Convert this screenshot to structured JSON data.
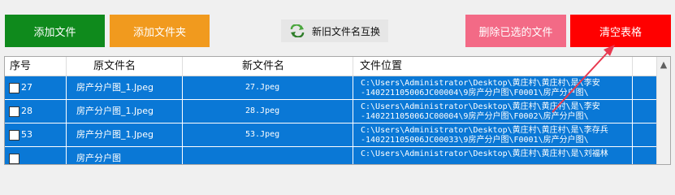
{
  "toolbar": {
    "add_file": "添加文件",
    "add_folder": "添加文件夹",
    "swap": "新旧文件名互换",
    "delete_selected": "删除已选的文件",
    "clear_table": "清空表格"
  },
  "table": {
    "headers": [
      "序号",
      "原文件名",
      "新文件名",
      "文件位置"
    ],
    "rows": [
      {
        "index": "27",
        "original": "房产分户图_1.Jpeg",
        "new_name": "27.Jpeg",
        "path_line1": "C:\\Users\\Administrator\\Desktop\\黄庄村\\黄庄村\\是\\李安",
        "path_line2": "-140221105006JC00004\\9房产分户图\\F0001\\房产分户图\\"
      },
      {
        "index": "28",
        "original": "房产分户图_1.Jpeg",
        "new_name": "28.Jpeg",
        "path_line1": "C:\\Users\\Administrator\\Desktop\\黄庄村\\黄庄村\\是\\李安",
        "path_line2": "-140221105006JC00004\\9房产分户图\\F0002\\房产分户图\\"
      },
      {
        "index": "53",
        "original": "房产分户图_1.Jpeg",
        "new_name": "53.Jpeg",
        "path_line1": "C:\\Users\\Administrator\\Desktop\\黄庄村\\黄庄村\\是\\李存兵",
        "path_line2": "-140221105006JC00033\\9房产分户图\\F0001\\房产分户图\\"
      },
      {
        "index": "",
        "original": "房产分户图",
        "new_name": "",
        "path_line1": "C:\\Users\\Administrator\\Desktop\\黄庄村\\黄庄村\\是\\刘福林",
        "path_line2": ""
      }
    ]
  },
  "colors": {
    "add_file": "#0f8a1c",
    "add_folder": "#f19a1e",
    "delete_selected": "#f36a86",
    "clear_table": "#ff0000",
    "row_selected": "#0a78d6",
    "arrow": "#e8394f"
  },
  "icons": {
    "swap": "swap-arrows-icon",
    "scroll_up": "chevron-up-icon"
  }
}
